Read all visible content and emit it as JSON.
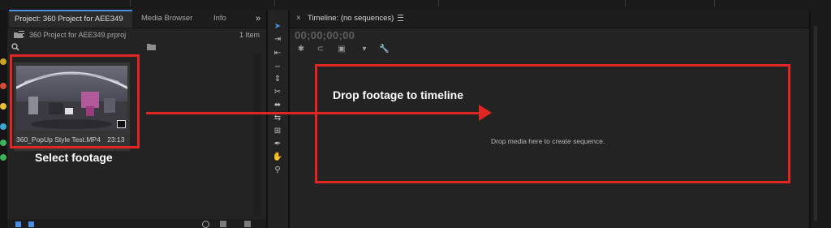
{
  "project_panel": {
    "tabs": [
      {
        "label": "Project: 360 Project for AEE349"
      },
      {
        "label": "Media Browser"
      },
      {
        "label": "Info"
      }
    ],
    "overflow_label": "»",
    "project_file": "360 Project for AEE349.prproj",
    "item_count": "1 Item",
    "clip": {
      "name": "360_PopUp Style Test.MP4",
      "duration": "23:13"
    }
  },
  "timeline_panel": {
    "tab_label": "Timeline: (no sequences)",
    "close_label": "×",
    "timecode": "00;00;00;00",
    "empty_message": "Drop media here to create sequence."
  },
  "annotations": {
    "select_label": "Select footage",
    "drop_label": "Drop footage to timeline",
    "color": "#e02623"
  },
  "colors": {
    "panel_bg": "#232323",
    "tab_bar": "#1c1c1c",
    "active_tab_accent": "#4a8fe2"
  }
}
